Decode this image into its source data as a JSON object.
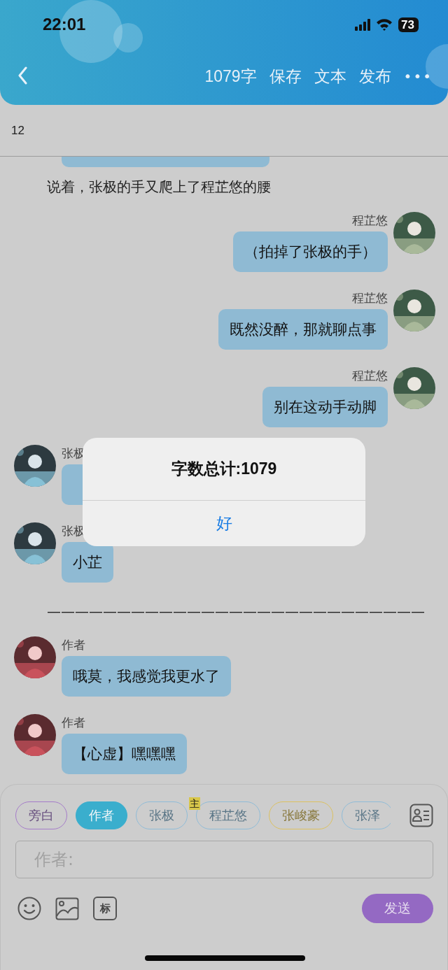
{
  "status_bar": {
    "time": "22:01",
    "battery": "73"
  },
  "nav": {
    "actions": [
      "1079字",
      "保存",
      "文本",
      "发布"
    ],
    "more": "•••"
  },
  "subbar": {
    "text": "12"
  },
  "messages": [
    {
      "kind": "edge"
    },
    {
      "kind": "narration",
      "text": "说着，张极的手又爬上了程芷悠的腰"
    },
    {
      "kind": "outgoing",
      "name": "程芷悠",
      "text": "（拍掉了张极的手）"
    },
    {
      "kind": "outgoing",
      "name": "程芷悠",
      "text": "既然没醉，那就聊点事"
    },
    {
      "kind": "outgoing",
      "name": "程芷悠",
      "text": "别在这动手动脚"
    },
    {
      "kind": "incoming",
      "name": "张极"
    },
    {
      "kind": "incoming",
      "name": "张极",
      "text": "小芷"
    },
    {
      "kind": "narration",
      "text": "———————————————————————————"
    },
    {
      "kind": "incoming",
      "name": "作者",
      "text": "哦莫，我感觉我更水了"
    },
    {
      "kind": "incoming",
      "name": "作者",
      "text": "【心虚】嘿嘿嘿"
    }
  ],
  "roles": [
    {
      "label": "旁白",
      "color": "#a57cc9",
      "selected": false
    },
    {
      "label": "作者",
      "color": "#3aaecd",
      "selected": true
    },
    {
      "label": "张极",
      "color": "#8fbcd8",
      "selected": false
    },
    {
      "label": "程芷悠",
      "color": "#8fbcd8",
      "selected": false,
      "badge": "主"
    },
    {
      "label": "张峻豪",
      "color": "#dcc160",
      "selected": false
    },
    {
      "label": "张泽",
      "color": "#8fbcd8",
      "selected": false
    }
  ],
  "input": {
    "placeholder": "作者:"
  },
  "tools": {
    "mark": "标",
    "send": "发送"
  },
  "alert": {
    "title": "字数总计:1079",
    "button": "好"
  }
}
